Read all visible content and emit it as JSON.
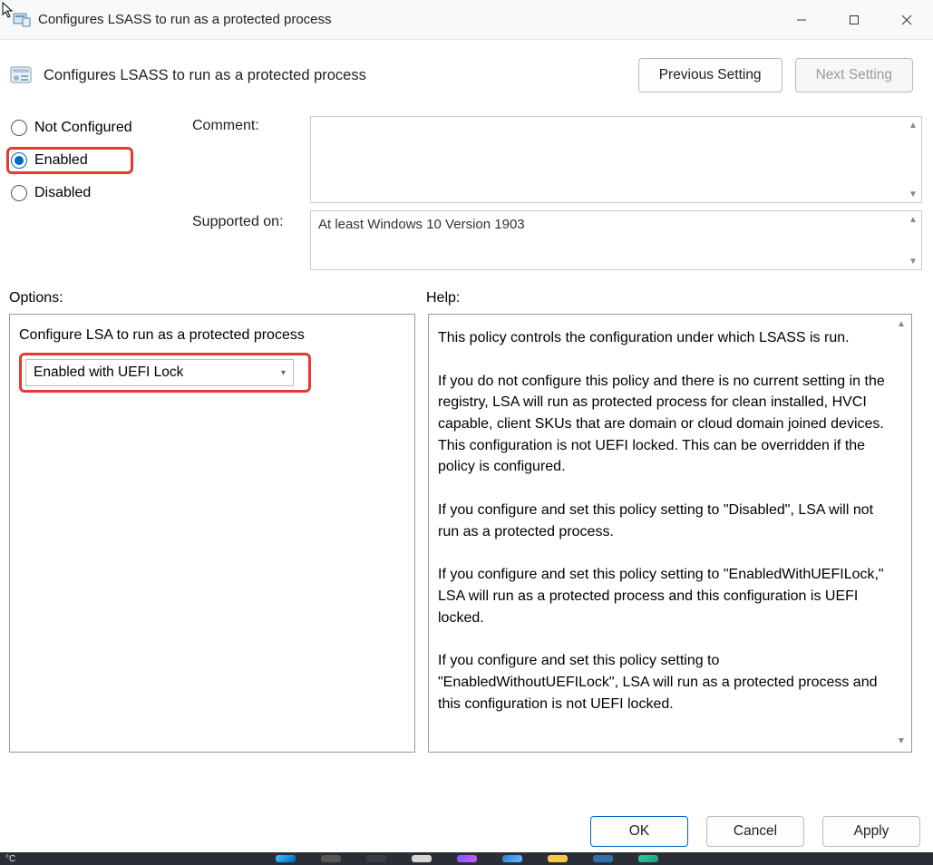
{
  "window": {
    "title": "Configures LSASS to run as a protected process"
  },
  "header": {
    "title": "Configures LSASS to run as a protected process",
    "prev_btn": "Previous Setting",
    "next_btn": "Next Setting"
  },
  "state_radios": {
    "not_configured": "Not Configured",
    "enabled": "Enabled",
    "disabled": "Disabled",
    "selected": "enabled"
  },
  "labels": {
    "comment": "Comment:",
    "supported_on": "Supported on:",
    "options": "Options:",
    "help": "Help:"
  },
  "comment_value": "",
  "supported_value": "At least Windows 10 Version 1903",
  "options": {
    "label": "Configure LSA to run as a protected process",
    "combo_value": "Enabled with UEFI Lock"
  },
  "help_paragraphs": {
    "p1": "This policy controls the configuration under which LSASS is run.",
    "p2": "If you do not configure this policy and there is no current setting in the registry, LSA will run as protected process for clean installed, HVCI capable, client SKUs that are domain or cloud domain joined devices. This configuration is not UEFI locked. This can be overridden if the policy is configured.",
    "p3": "If you configure and set this policy setting to \"Disabled\", LSA will not run as a protected process.",
    "p4": "If you configure and set this policy setting to \"EnabledWithUEFILock,\" LSA will run as a protected process and this configuration is UEFI locked.",
    "p5": "If you configure and set this policy setting to \"EnabledWithoutUEFILock\", LSA will run as a protected process and this configuration is not UEFI locked."
  },
  "footer": {
    "ok": "OK",
    "cancel": "Cancel",
    "apply": "Apply"
  },
  "taskbar": {
    "weather": "°C"
  }
}
